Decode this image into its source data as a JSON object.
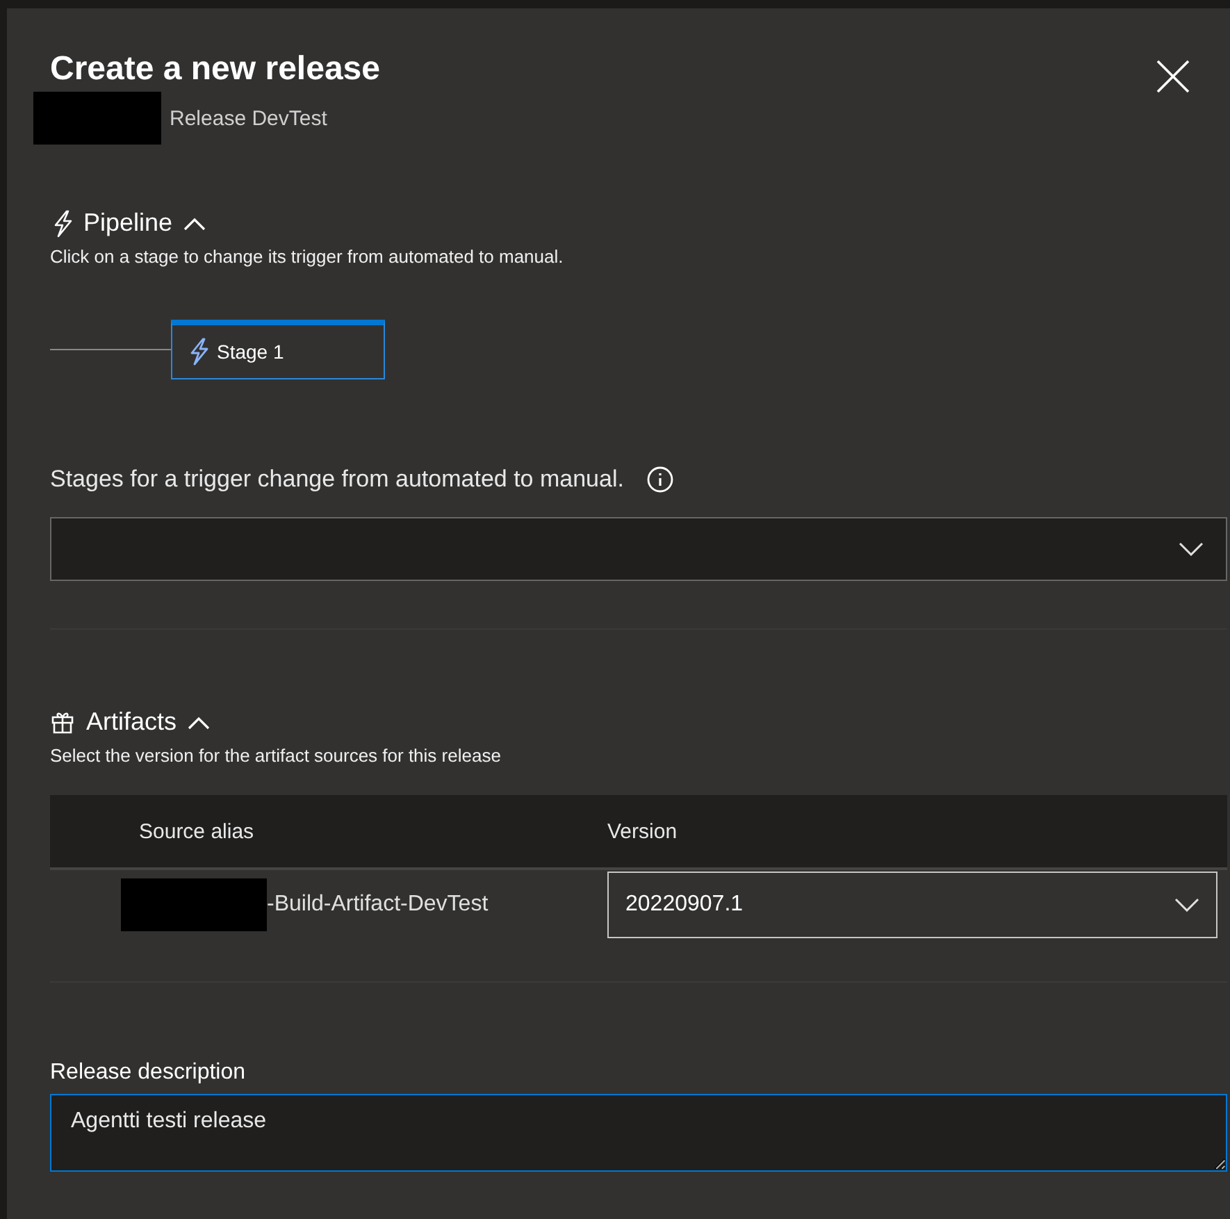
{
  "dialog": {
    "title": "Create a new release",
    "subtitle": "Release DevTest",
    "subtitle_redacted": true
  },
  "pipeline": {
    "heading": "Pipeline",
    "expanded": true,
    "description": "Click on a stage to change its trigger from automated to manual.",
    "stages": [
      {
        "name": "Stage 1",
        "selected": true
      }
    ]
  },
  "trigger_stages": {
    "label": "Stages for a trigger change from automated to manual."
  },
  "artifacts": {
    "heading": "Artifacts",
    "expanded": true,
    "description": "Select the version for the artifact sources for this release",
    "columns": [
      "Source alias",
      "Version"
    ],
    "rows": [
      {
        "source_alias": "-Build-Artifact-DevTest",
        "alias_redacted": true,
        "version": "20220907.1"
      }
    ]
  },
  "release_description": {
    "label": "Release description",
    "value": "Agentti testi release"
  }
}
